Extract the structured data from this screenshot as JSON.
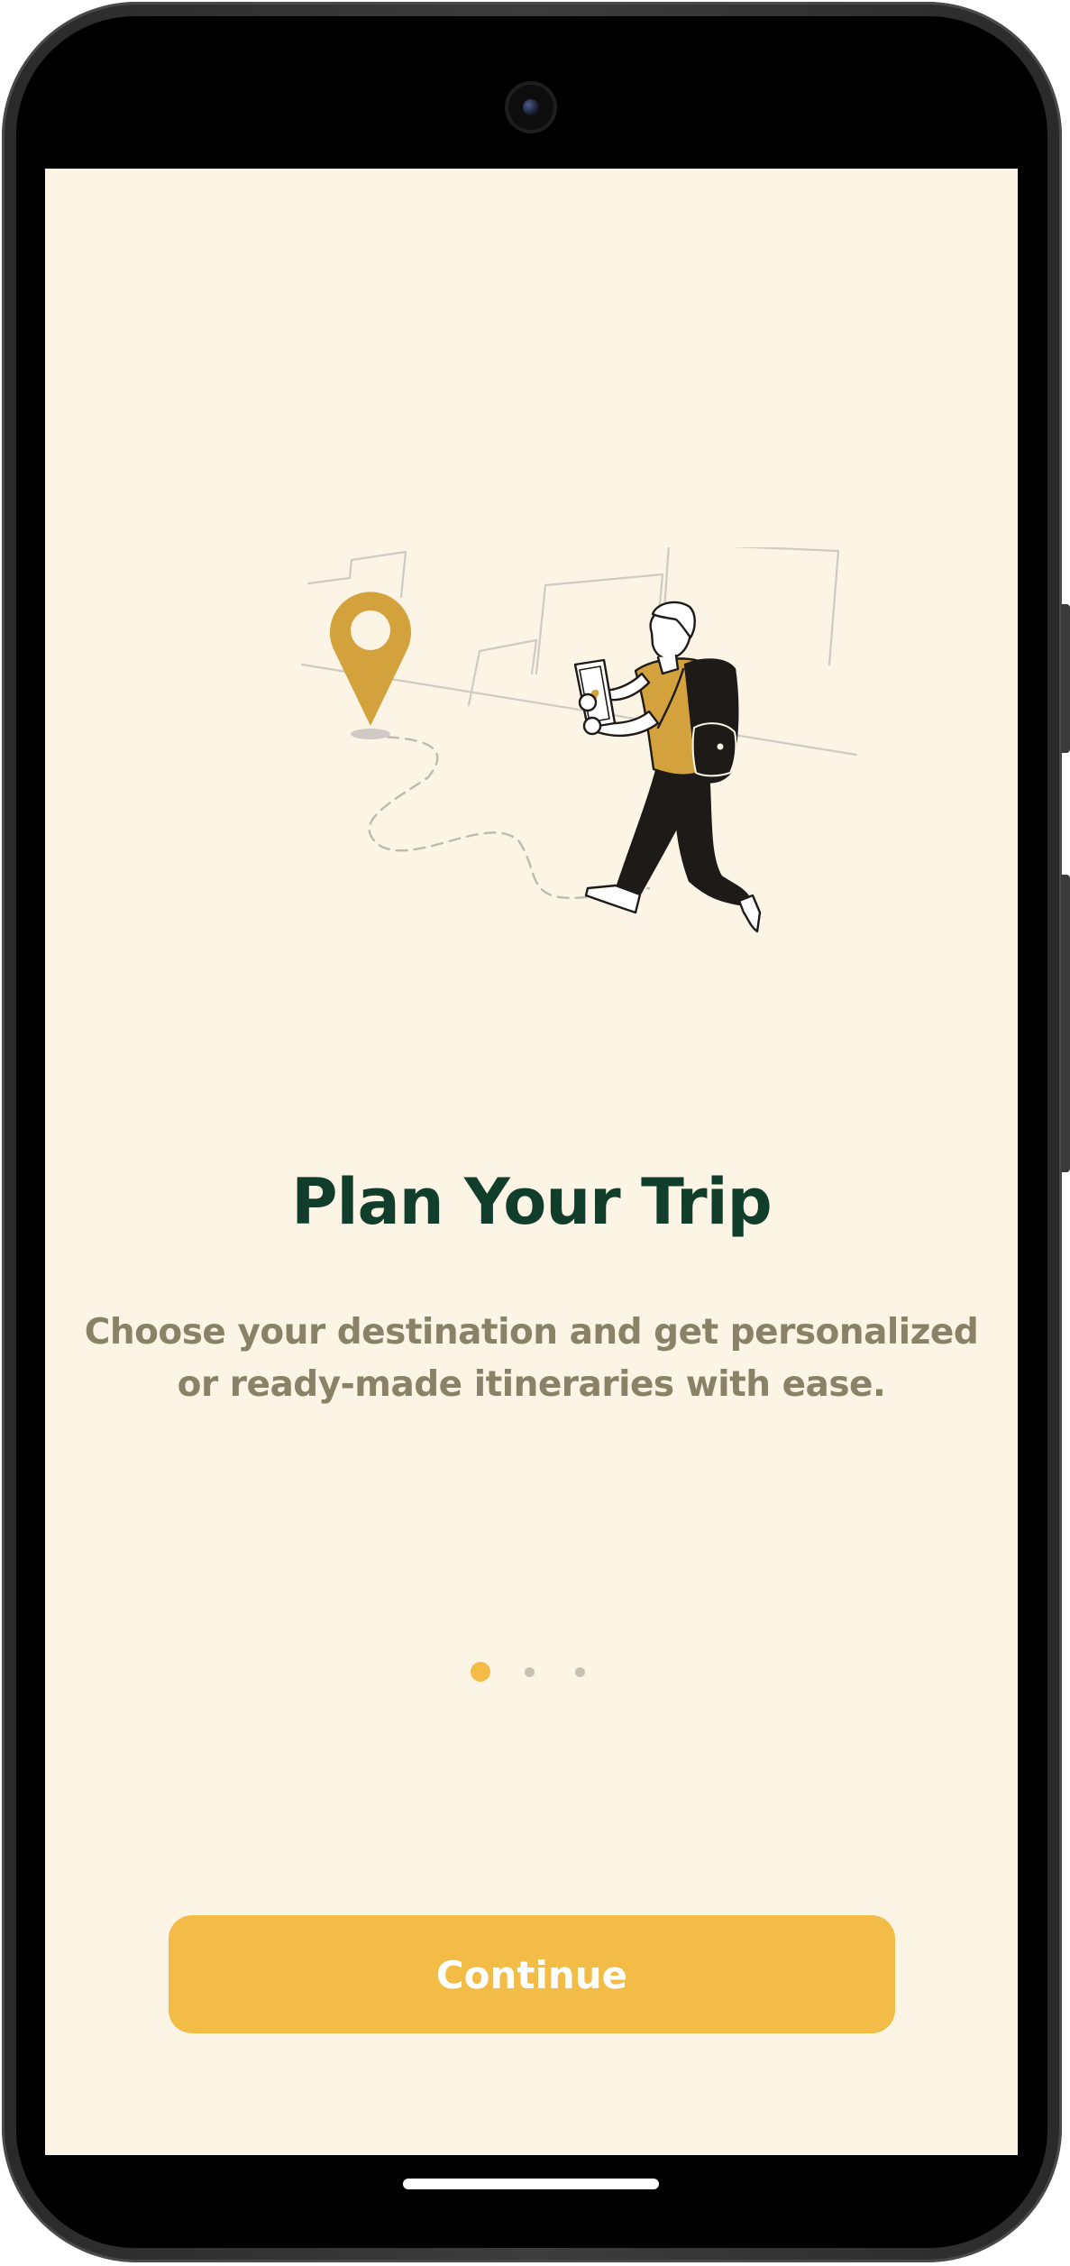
{
  "onboarding": {
    "title": "Plan Your Trip",
    "subtitle": "Choose your destination and get personalized or ready-made itineraries with ease.",
    "pagination": {
      "total": 3,
      "active_index": 0
    },
    "continue_label": "Continue",
    "illustration_icon": "traveler-with-map-pin-illustration"
  },
  "colors": {
    "background": "#FCF5E5",
    "title": "#113D2B",
    "subtitle": "#8B8167",
    "accent": "#F2BC46",
    "pin": "#D4A23C",
    "inactive_dot": "#C7C3B4"
  }
}
